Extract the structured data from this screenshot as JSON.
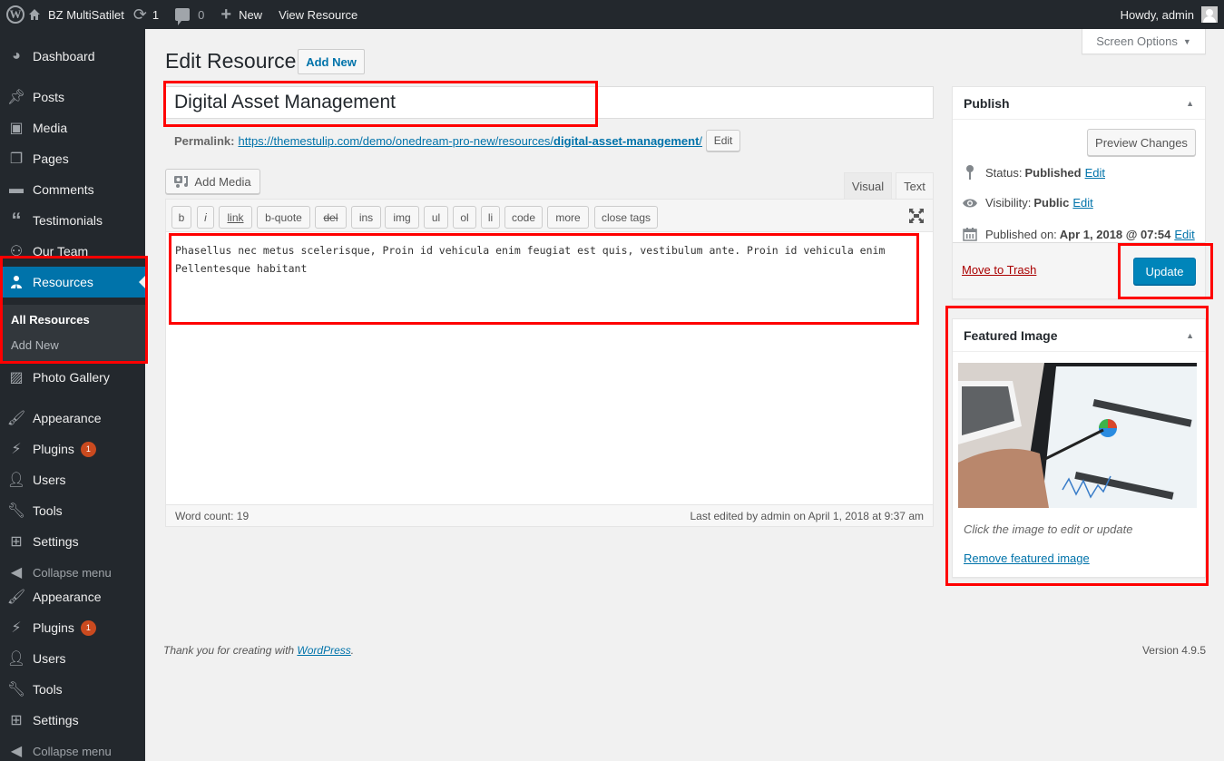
{
  "adminbar": {
    "site_name": "BZ MultiSatilet",
    "updates_count": "1",
    "comments_count": "0",
    "new_label": "New",
    "view_label": "View Resource",
    "greeting": "Howdy, admin"
  },
  "sidebar": {
    "items": [
      {
        "label": "Dashboard",
        "icon": "dashboard-icon"
      },
      {
        "label": "Posts",
        "icon": "pin-icon"
      },
      {
        "label": "Media",
        "icon": "media-icon"
      },
      {
        "label": "Pages",
        "icon": "pages-icon"
      },
      {
        "label": "Comments",
        "icon": "comment-icon"
      },
      {
        "label": "Testimonials",
        "icon": "quote-icon"
      },
      {
        "label": "Our Team",
        "icon": "groups-icon"
      },
      {
        "label": "Resources",
        "icon": "businessman-icon"
      },
      {
        "label": "Photo Gallery",
        "icon": "format-image-icon"
      },
      {
        "label": "Appearance",
        "icon": "paintbrush-icon"
      },
      {
        "label": "Plugins",
        "icon": "plugins-icon",
        "badge": "1"
      },
      {
        "label": "Users",
        "icon": "users-icon"
      },
      {
        "label": "Tools",
        "icon": "wrench-icon"
      },
      {
        "label": "Settings",
        "icon": "settings-icon"
      },
      {
        "label": "Collapse menu",
        "icon": "collapse-icon"
      },
      {
        "label": "Appearance",
        "icon": "paintbrush-icon"
      },
      {
        "label": "Plugins",
        "icon": "plugins-icon",
        "badge": "1"
      },
      {
        "label": "Users",
        "icon": "users-icon"
      },
      {
        "label": "Tools",
        "icon": "wrench-icon"
      },
      {
        "label": "Settings",
        "icon": "settings-icon"
      },
      {
        "label": "Collapse menu",
        "icon": "collapse-icon"
      }
    ],
    "submenu": [
      {
        "label": "All Resources"
      },
      {
        "label": "Add New"
      }
    ]
  },
  "main": {
    "screen_options": "Screen Options",
    "page_title": "Edit Resource",
    "add_new": "Add New",
    "post_title": "Digital Asset Management",
    "permalink_label": "Permalink:",
    "permalink_base": "https://themestulip.com/demo/onedream-pro-new/resources/",
    "permalink_slug": "digital-asset-management",
    "permalink_trail": "/",
    "permalink_edit": "Edit",
    "add_media": "Add Media",
    "tab_visual": "Visual",
    "tab_text": "Text",
    "quicktags": [
      "b",
      "i",
      "link",
      "b-quote",
      "del",
      "ins",
      "img",
      "ul",
      "ol",
      "li",
      "code",
      "more",
      "close tags"
    ],
    "content": "Phasellus nec metus scelerisque, Proin id vehicula enim feugiat est quis, vestibulum ante. Proin id vehicula enim\nPellentesque habitant",
    "word_count": "Word count: 19",
    "last_edited": "Last edited by admin on April 1, 2018 at 9:37 am"
  },
  "publish": {
    "title": "Publish",
    "preview": "Preview Changes",
    "status_label": "Status:",
    "status_value": "Published",
    "visibility_label": "Visibility:",
    "visibility_value": "Public",
    "published_label": "Published on:",
    "published_value": "Apr 1, 2018 @ 07:54",
    "edit": "Edit",
    "trash": "Move to Trash",
    "update": "Update"
  },
  "featured": {
    "title": "Featured Image",
    "caption": "Click the image to edit or update",
    "remove": "Remove featured image"
  },
  "footer": {
    "thanks_prefix": "Thank you for creating with ",
    "wordpress_link": "WordPress",
    "thanks_suffix": ".",
    "version": "Version 4.9.5"
  },
  "colors": {
    "accent": "#0073aa",
    "adminbar": "#23282d",
    "highlight_box": "#ff0000",
    "badge": "#ca4a1f",
    "update_button": "#0085ba"
  }
}
